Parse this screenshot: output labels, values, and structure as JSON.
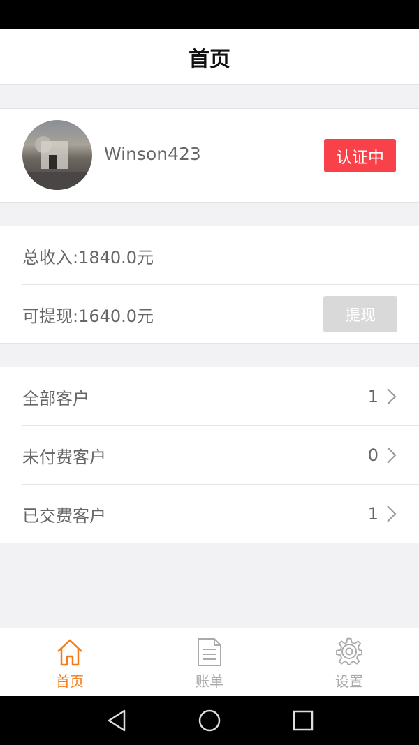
{
  "header": {
    "title": "首页"
  },
  "profile": {
    "username": "Winson423",
    "status_badge": "认证中"
  },
  "income": {
    "total_label": "总收入:1840.0元",
    "withdrawable_label": "可提现:1640.0元",
    "withdraw_button": "提现"
  },
  "customers": [
    {
      "label": "全部客户",
      "count": "1"
    },
    {
      "label": "未付费客户",
      "count": "0"
    },
    {
      "label": "已交费客户",
      "count": "1"
    }
  ],
  "tabbar": {
    "active_color": "#f27c1c",
    "items": [
      {
        "label": "首页",
        "icon": "home-icon",
        "active": true
      },
      {
        "label": "账单",
        "icon": "document-icon",
        "active": false
      },
      {
        "label": "设置",
        "icon": "gear-icon",
        "active": false
      }
    ]
  },
  "colors": {
    "badge": "#f84149",
    "background": "#f2f2f4"
  }
}
